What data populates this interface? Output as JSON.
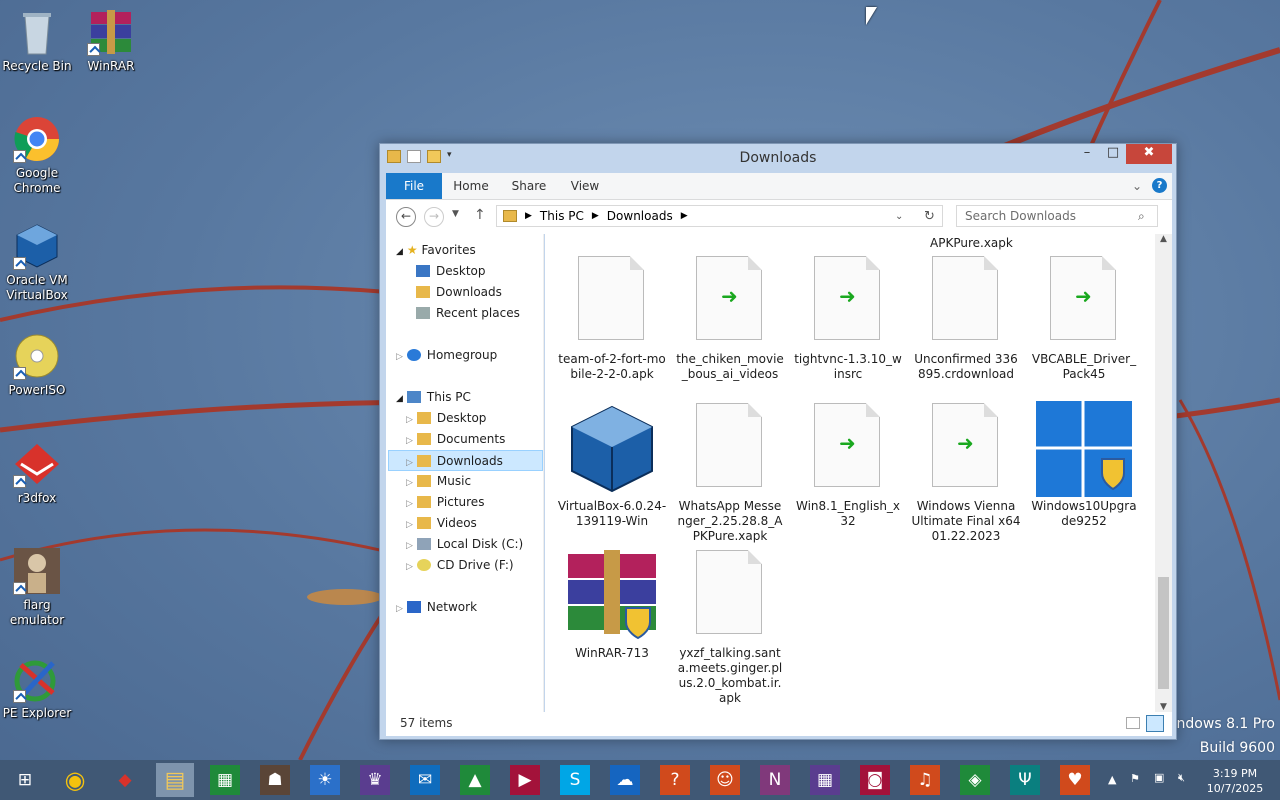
{
  "desktop": {
    "icons": [
      {
        "label": "Recycle Bin",
        "icon": "recycle-bin-icon"
      },
      {
        "label": "WinRAR",
        "icon": "winrar-icon"
      },
      {
        "label": "Google Chrome",
        "icon": "chrome-icon"
      },
      {
        "label": "Oracle VM VirtualBox",
        "icon": "virtualbox-icon"
      },
      {
        "label": "PowerISO",
        "icon": "poweriso-icon"
      },
      {
        "label": "r3dfox",
        "icon": "r3dfox-icon"
      },
      {
        "label": "flarg emulator",
        "icon": "flarg-icon"
      },
      {
        "label": "PE Explorer",
        "icon": "pe-explorer-icon"
      }
    ],
    "watermark": {
      "line1": "Windows 8.1 Pro",
      "line2": "Build 9600"
    }
  },
  "explorer": {
    "title": "Downloads",
    "controls": {
      "minimize": "–",
      "maximize": "□",
      "close": "✖"
    },
    "ribbon_tabs": [
      "File",
      "Home",
      "Share",
      "View"
    ],
    "breadcrumb": [
      "This PC",
      "Downloads"
    ],
    "search_placeholder": "Search Downloads",
    "nav": {
      "favorites": "Favorites",
      "desktop": "Desktop",
      "downloads": "Downloads",
      "recent": "Recent places",
      "homegroup": "Homegroup",
      "thispc": "This PC",
      "pc_desktop": "Desktop",
      "documents": "Documents",
      "pc_downloads": "Downloads",
      "music": "Music",
      "pictures": "Pictures",
      "videos": "Videos",
      "localdisk": "Local Disk (C:)",
      "cddrive": "CD Drive (F:)",
      "network": "Network"
    },
    "partial_label": "APKPure.xapk",
    "files": [
      {
        "name": "team-of-2-fort-mobile-2-2-0.apk",
        "type": "blank"
      },
      {
        "name": "the_chiken_movie_bous_ai_videos",
        "type": "shortcut"
      },
      {
        "name": "tightvnc-1.3.10_winsrc",
        "type": "shortcut"
      },
      {
        "name": "Unconfirmed 336895.crdownload",
        "type": "blank"
      },
      {
        "name": "VBCABLE_Driver_Pack45",
        "type": "shortcut"
      },
      {
        "name": "VirtualBox-6.0.24-139119-Win",
        "type": "virtualbox"
      },
      {
        "name": "WhatsApp Messenger_2.25.28.8_APKPure.xapk",
        "type": "blank"
      },
      {
        "name": "Win8.1_English_x32",
        "type": "shortcut"
      },
      {
        "name": "Windows Vienna Ultimate Final x64 01.22.2023",
        "type": "shortcut"
      },
      {
        "name": "Windows10Upgrade9252",
        "type": "win10"
      },
      {
        "name": "WinRAR-713",
        "type": "winrar"
      },
      {
        "name": "yxzf_talking.santa.meets.ginger.plus.2.0_kombat.ir.apk",
        "type": "blank"
      }
    ],
    "status": "57 items"
  },
  "taskbar": {
    "apps": [
      "start-icon",
      "chrome-icon",
      "r3dfox-icon",
      "file-explorer-icon",
      "store-icon",
      "flarg-icon",
      "weather-icon",
      "trophy-icon",
      "mail-icon",
      "finance-icon",
      "video-icon",
      "skype-icon",
      "onedrive-icon",
      "help-icon",
      "people-icon",
      "onenote-icon",
      "calendar-icon",
      "camera-icon",
      "music-icon",
      "games-icon",
      "food-icon",
      "health-icon"
    ],
    "time": "3:19 PM",
    "date": "10/7/2025"
  },
  "colors": {
    "accent": "#1979ca",
    "taskbar": "#405875",
    "close": "#c7463b",
    "selection": "#cce8ff"
  }
}
